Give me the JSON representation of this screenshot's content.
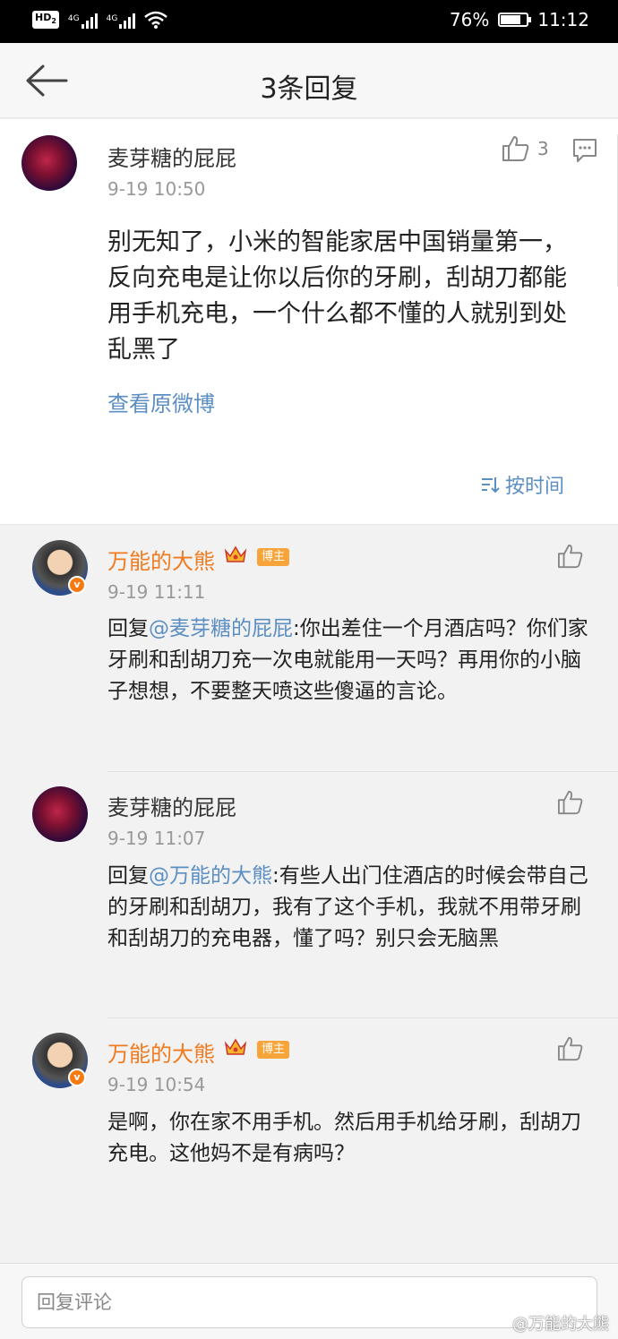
{
  "status_bar": {
    "hd_label": "HD",
    "hd_sub": "2",
    "signal1_label": "4G",
    "signal2_label": "4G",
    "battery_percent": "76%",
    "battery_level": 0.76,
    "time": "11:12"
  },
  "nav": {
    "title": "3条回复"
  },
  "main_comment": {
    "username": "麦芽糖的屁屁",
    "timestamp": "9-19 10:50",
    "like_count": "3",
    "text": "别无知了，小米的智能家居中国销量第一，反向充电是让你以后你的牙刷，刮胡刀都能用手机充电，一个什么都不懂的人就别到处乱黑了",
    "view_original_label": "查看原微博",
    "sort_label": "按时间"
  },
  "replies": [
    {
      "username": "万能的大熊",
      "owner_badge": "博主",
      "timestamp": "9-19 11:11",
      "prefix": "回复",
      "mention": "@麦芽糖的屁屁",
      "text": ":你出差住一个月酒店吗？你们家牙刷和刮胡刀充一次电就能用一天吗？再用你的小脑子想想，不要整天喷这些傻逼的言论。"
    },
    {
      "username": "麦芽糖的屁屁",
      "timestamp": "9-19 11:07",
      "prefix": "回复",
      "mention": "@万能的大熊",
      "text": ":有些人出门住酒店的时候会带自己的牙刷和刮胡刀，我有了这个手机，我就不用带牙刷和刮胡刀的充电器，懂了吗？别只会无脑黑"
    },
    {
      "username": "万能的大熊",
      "owner_badge": "博主",
      "timestamp": "9-19 10:54",
      "text": "是啊，你在家不用手机。然后用手机给牙刷，刮胡刀充电。这他妈不是有病吗？"
    }
  ],
  "reply_box": {
    "placeholder": "回复评论"
  },
  "watermark": "@万能的大熊",
  "colors": {
    "link_blue": "#5b8ec3",
    "vip_orange": "#f07a1d",
    "badge_orange": "#f7a53a"
  }
}
